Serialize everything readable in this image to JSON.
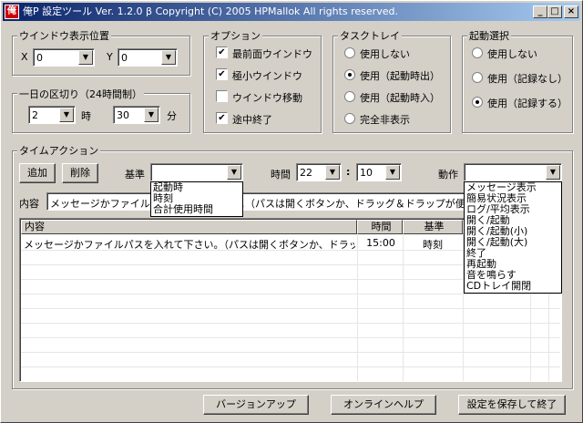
{
  "window": {
    "icon_glyph": "俺",
    "title": "俺P 設定ツール Ver. 1.2.0 β Copyright (C) 2005 HPMallok All rights reserved.",
    "minimize": "_",
    "maximize": "□",
    "close": "×"
  },
  "window_position": {
    "label": "ウインドウ表示位置",
    "x_label": "X",
    "x_value": "0",
    "y_label": "Y",
    "y_value": "0"
  },
  "day_break": {
    "label": "一日の区切り（24時間制）",
    "hour_value": "2",
    "hour_unit": "時",
    "minute_value": "30",
    "minute_unit": "分"
  },
  "options": {
    "label": "オプション",
    "items": [
      {
        "label": "最前面ウインドウ",
        "checked": "✔"
      },
      {
        "label": "極小ウインドウ",
        "checked": "✔"
      },
      {
        "label": "ウインドウ移動",
        "checked": ""
      },
      {
        "label": "途中終了",
        "checked": "✔"
      }
    ]
  },
  "tasktray": {
    "label": "タスクトレイ",
    "items": [
      {
        "label": "使用しない"
      },
      {
        "label": "使用（起動時出）"
      },
      {
        "label": "使用（起動時入）"
      },
      {
        "label": "完全非表示"
      }
    ],
    "selected": 1
  },
  "startup": {
    "label": "起動選択",
    "items": [
      {
        "label": "使用しない"
      },
      {
        "label": "使用（記録なし）"
      },
      {
        "label": "使用（記録する）"
      }
    ],
    "selected": 2
  },
  "time_action": {
    "label": "タイムアクション",
    "add_button": "追加",
    "delete_button": "削除",
    "basis_label": "基準",
    "basis_value": "",
    "basis_options": [
      "起動時",
      "時刻",
      "合計使用時間"
    ],
    "time_label": "時間",
    "hour_value": "22",
    "colon": ":",
    "minute_value": "10",
    "action_label": "動作",
    "action_value": "",
    "action_options": [
      "メッセージ表示",
      "簡易状況表示",
      "ログ/平均表示",
      "開く/起動",
      "開く/起動(小)",
      "開く/起動(大)",
      "終了",
      "再起動",
      "音を鳴らす",
      "CDトレイ開閉"
    ],
    "content_label": "内容",
    "content_value": "メッセージかファイルパスを入れて下さい。（パスは開くボタンか、ドラッグ＆ドラップが便利）",
    "columns": [
      "内容",
      "時間",
      "基準"
    ],
    "rows": [
      {
        "content": "メッセージかファイルパスを入れて下さい。（パスは開くボタンか、ドラッ...",
        "time": "15:00",
        "basis": "時刻"
      }
    ]
  },
  "footer": {
    "version_up": "バージョンアップ",
    "online_help": "オンラインヘルプ",
    "save_exit": "設定を保存して終了"
  }
}
